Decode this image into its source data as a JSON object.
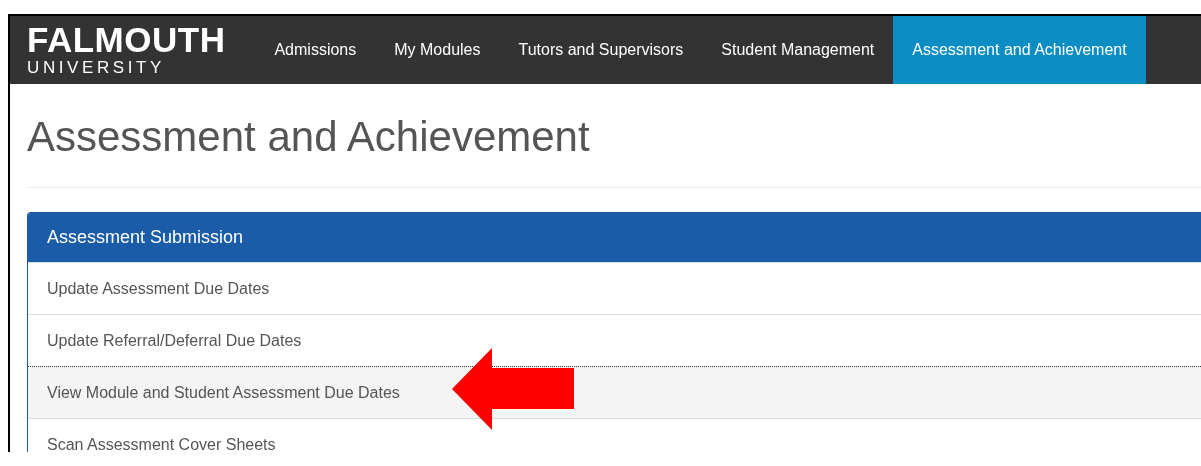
{
  "logo": {
    "name": "FALMOUTH",
    "subtitle": "UNIVERSITY"
  },
  "nav": [
    {
      "label": "Admissions",
      "selected": false
    },
    {
      "label": "My Modules",
      "selected": false
    },
    {
      "label": "Tutors and Supervisors",
      "selected": false
    },
    {
      "label": "Student Management",
      "selected": false
    },
    {
      "label": "Assessment and Achievement",
      "selected": true
    }
  ],
  "page_title": "Assessment and Achievement",
  "panel": {
    "title": "Assessment Submission",
    "items": [
      {
        "label": "Update Assessment Due Dates",
        "selected": false
      },
      {
        "label": "Update Referral/Deferral Due Dates",
        "selected": false
      },
      {
        "label": "View Module and Student Assessment Due Dates",
        "selected": true
      },
      {
        "label": "Scan Assessment Cover Sheets",
        "selected": false
      }
    ]
  }
}
